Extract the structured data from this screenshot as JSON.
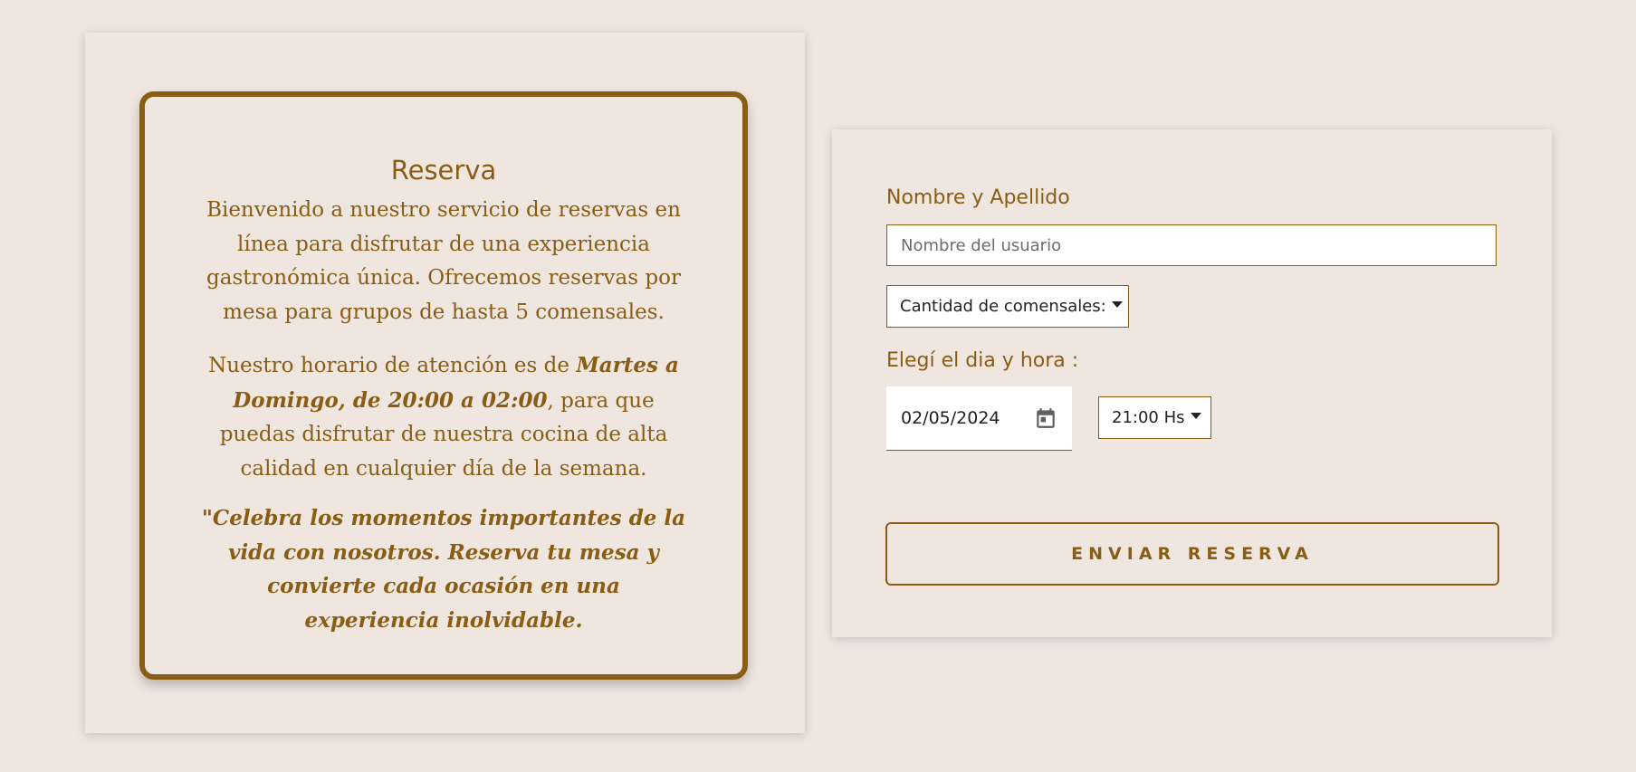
{
  "info": {
    "title": "Reserva",
    "p1": "Bienvenido a nuestro servicio de reservas en línea para disfrutar de una experiencia gastronómica única. Ofrecemos reservas por mesa para grupos de hasta 5 comensales.",
    "p2_pre": "Nuestro horario de atención es de ",
    "p2_bold": "Martes a Domingo, de 20:00 a 02:00",
    "p2_post": ", para que puedas disfrutar de nuestra cocina de alta calidad en cualquier día de la semana.",
    "quote": "\"Celebra los momentos importantes de la vida con nosotros. Reserva tu mesa y convierte cada ocasión en una experiencia inolvidable."
  },
  "form": {
    "name_label": "Nombre y Apellido",
    "name_placeholder": "Nombre del usuario",
    "name_value": "",
    "comensales_label": "Cantidad de comensales:",
    "date_label": "Elegí el dia y hora :",
    "date_value": "02/05/2024",
    "date_icon": "calendar-icon",
    "time_value": "21:00 Hs",
    "submit_label": "ENVIAR RESERVA"
  },
  "colors": {
    "accent": "#8a5d14",
    "background": "#efe6e0"
  }
}
